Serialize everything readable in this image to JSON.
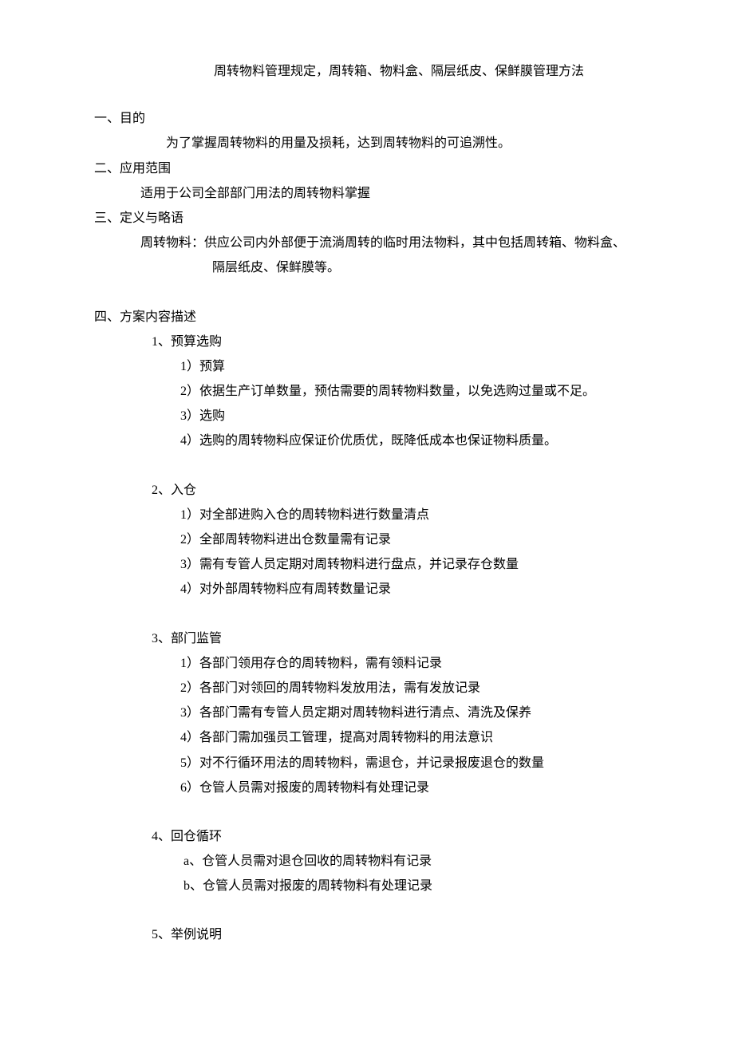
{
  "title": "周转物料管理规定，周转箱、物料盒、隔层纸皮、保鲜膜管理方法",
  "s1": {
    "heading": "一、目的",
    "text": "为了掌握周转物料的用量及损耗，达到周转物料的可追溯性。"
  },
  "s2": {
    "heading": "二、应用范围",
    "text": "适用于公司全部部门用法的周转物料掌握"
  },
  "s3": {
    "heading": "三、定义与略语",
    "text_line1": "周转物料：供应公司内外部便于流淌周转的临时用法物料，其中包括周转箱、物料盒、",
    "text_line2": "隔层纸皮、保鲜膜等。"
  },
  "s4": {
    "heading": "四、方案内容描述",
    "sec1": {
      "title": "1、预算选购",
      "items": [
        "1）预算",
        "2）依据生产订单数量，预估需要的周转物料数量，以免选购过量或不足。",
        "3）选购",
        "4）选购的周转物料应保证价优质优，既降低成本也保证物料质量。"
      ]
    },
    "sec2": {
      "title": "2、入仓",
      "items": [
        "1）对全部进购入仓的周转物料进行数量清点",
        "2）全部周转物料进出仓数量需有记录",
        "3）需有专管人员定期对周转物料进行盘点，并记录存仓数量",
        "4）对外部周转物料应有周转数量记录"
      ]
    },
    "sec3": {
      "title": "3、部门监管",
      "items": [
        "1）各部门领用存仓的周转物料，需有领料记录",
        "2）各部门对领回的周转物料发放用法，需有发放记录",
        "3）各部门需有专管人员定期对周转物料进行清点、清洗及保养",
        "4）各部门需加强员工管理，提高对周转物料的用法意识",
        "5）对不行循环用法的周转物料，需退仓，并记录报废退仓的数量",
        "6）仓管人员需对报废的周转物料有处理记录"
      ]
    },
    "sec4": {
      "title": "4、回仓循环",
      "items": [
        "a、仓管人员需对退仓回收的周转物料有记录",
        "b、仓管人员需对报废的周转物料有处理记录"
      ]
    },
    "sec5": {
      "title": "5、举例说明"
    }
  }
}
